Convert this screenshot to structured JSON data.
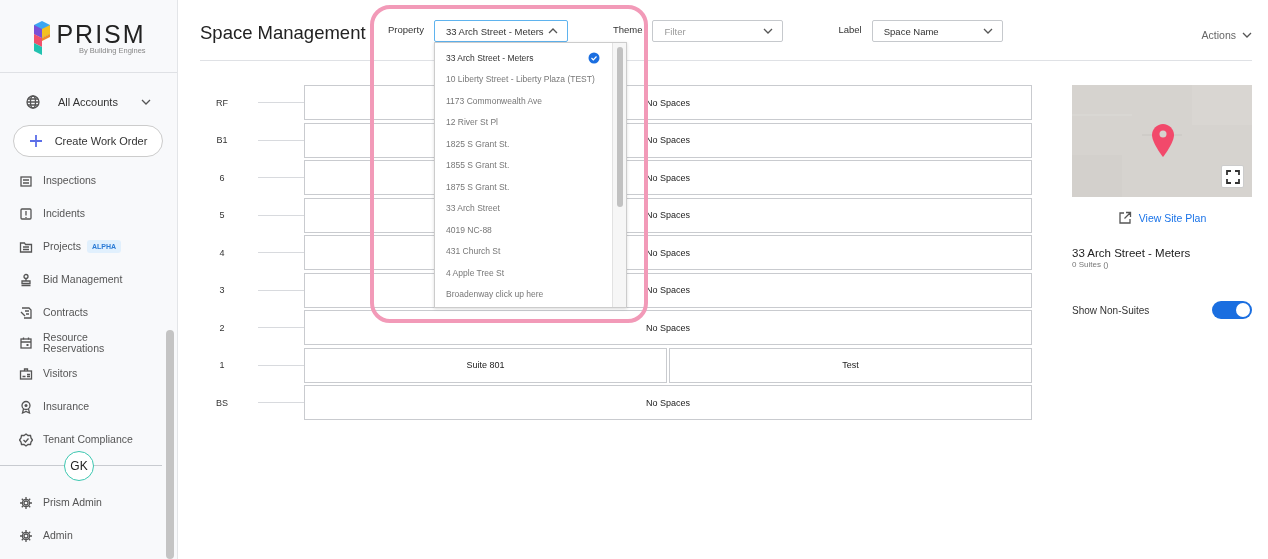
{
  "sidebar": {
    "logo": {
      "name": "PRISM",
      "tagline": "By Building Engines"
    },
    "account": "All Accounts",
    "create_button": "Create Work Order",
    "items": [
      {
        "label": "Inspections",
        "kind": "clipboard"
      },
      {
        "label": "Incidents",
        "kind": "alert"
      },
      {
        "label": "Projects",
        "kind": "folder",
        "badge": "ALPHA"
      },
      {
        "label": "Bid Management",
        "kind": "stamp"
      },
      {
        "label": "Contracts",
        "kind": "contract"
      },
      {
        "label": "Resource Reservations",
        "kind": "calendar"
      },
      {
        "label": "Visitors",
        "kind": "idcard"
      },
      {
        "label": "Insurance",
        "kind": "award"
      },
      {
        "label": "Tenant Compliance",
        "kind": "checkbadge"
      }
    ],
    "avatar": "GK",
    "admin_items": [
      {
        "label": "Prism Admin",
        "kind": "gear"
      },
      {
        "label": "Admin",
        "kind": "gear"
      }
    ]
  },
  "header": {
    "title": "Space Management",
    "filters": [
      {
        "label": "Property",
        "value": "33 Arch Street - Meters",
        "expanded": true
      },
      {
        "label": "Theme",
        "placeholder": "Filter",
        "expanded": false
      },
      {
        "label": "Label",
        "value": "Space Name",
        "expanded": false
      }
    ],
    "actions": "Actions"
  },
  "property_dropdown": {
    "options": [
      {
        "label": "33 Arch Street - Meters",
        "selected": true
      },
      {
        "label": "10 Liberty Street - Liberty Plaza (TEST)",
        "selected": false
      },
      {
        "label": "1173 Commonwealth Ave",
        "selected": false
      },
      {
        "label": "12 River St Pl",
        "selected": false
      },
      {
        "label": "1825 S Grant St.",
        "selected": false
      },
      {
        "label": "1855 S Grant St.",
        "selected": false
      },
      {
        "label": "1875 S Grant St.",
        "selected": false
      },
      {
        "label": "33 Arch Street",
        "selected": false
      },
      {
        "label": "4019 NC-88",
        "selected": false
      },
      {
        "label": "431 Church St",
        "selected": false
      },
      {
        "label": "4 Apple Tree St",
        "selected": false
      },
      {
        "label": "Broadenway click up here",
        "selected": false
      }
    ]
  },
  "floors": [
    {
      "label": "RF",
      "spaces": [
        "No Spaces"
      ]
    },
    {
      "label": "B1",
      "spaces": [
        "No Spaces"
      ]
    },
    {
      "label": "6",
      "spaces": [
        "No Spaces"
      ]
    },
    {
      "label": "5",
      "spaces": [
        "No Spaces"
      ]
    },
    {
      "label": "4",
      "spaces": [
        "No Spaces"
      ]
    },
    {
      "label": "3",
      "spaces": [
        "No Spaces"
      ]
    },
    {
      "label": "2",
      "spaces": [
        "No Spaces"
      ]
    },
    {
      "label": "1",
      "spaces": [
        "Suite 801",
        "Test"
      ]
    },
    {
      "label": "BS",
      "spaces": [
        "No Spaces"
      ]
    }
  ],
  "details": {
    "site_plan_link": "View Site Plan",
    "property_name": "33 Arch Street - Meters",
    "suites": "0 Suites ()",
    "toggle": {
      "label": "Show Non-Suites",
      "on": true
    }
  }
}
